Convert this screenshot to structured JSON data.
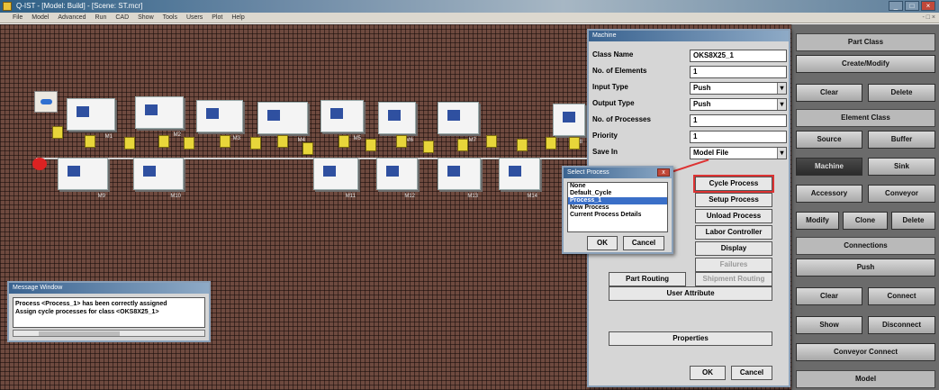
{
  "window": {
    "title": "Q-IST - [Model: Build] - [Scene: ST.mcr]",
    "controls": [
      "_",
      "□",
      "×"
    ]
  },
  "menubar": {
    "items": [
      "File",
      "Model",
      "Advanced",
      "Run",
      "CAD",
      "Show",
      "Tools",
      "Users",
      "Plot",
      "Help"
    ],
    "right": "- □ ×"
  },
  "workspace": {
    "machines_top": [
      {
        "label": "M1"
      },
      {
        "label": "M2"
      },
      {
        "label": "M3"
      },
      {
        "label": "M4"
      },
      {
        "label": "M5"
      },
      {
        "label": "M6"
      },
      {
        "label": "M7"
      },
      {
        "label": "M8"
      }
    ],
    "machines_bottom": [
      {
        "label": "M9"
      },
      {
        "label": "M10"
      },
      {
        "label": "M11"
      },
      {
        "label": "M12"
      },
      {
        "label": "M13"
      },
      {
        "label": "M14"
      }
    ]
  },
  "machine_dialog": {
    "title": "Machine",
    "fields": [
      {
        "label": "Class Name",
        "value": "OKS8X25_1"
      },
      {
        "label": "No. of Elements",
        "value": "1"
      },
      {
        "label": "Input Type",
        "value": "Push"
      },
      {
        "label": "Output Type",
        "value": "Push"
      },
      {
        "label": "No. of Processes",
        "value": "1"
      },
      {
        "label": "Priority",
        "value": "1"
      },
      {
        "label": "Save In",
        "value": "Model File"
      }
    ],
    "buttons": {
      "cycle_process": "Cycle Process",
      "setup_process": "Setup Process",
      "unload_process": "Unload Process",
      "labor_controller": "Labor Controller",
      "display": "Display",
      "failures": "Failures",
      "part_routing": "Part Routing",
      "shipment_routing": "Shipment Routing",
      "user_attribute": "User Attribute",
      "properties": "Properties",
      "ok": "OK",
      "cancel": "Cancel"
    }
  },
  "select_process_dialog": {
    "title": "Select Process",
    "items": [
      "None",
      "Default_Cycle",
      "Process_1",
      "New Process",
      "Current Process Details"
    ],
    "selected_index": 2,
    "ok": "OK",
    "cancel": "Cancel"
  },
  "message_window": {
    "title": "Message Window",
    "lines": [
      "Process <Process_1> has been correctly assigned",
      "Assign cycle processes for class <OKS8X25_1>"
    ]
  },
  "right_panel": {
    "part_class": "Part Class",
    "create_modify": "Create/Modify",
    "clear": "Clear",
    "delete": "Delete",
    "element_class": "Element Class",
    "source": "Source",
    "buffer": "Buffer",
    "machine": "Machine",
    "sink": "Sink",
    "accessory": "Accessory",
    "conveyor": "Conveyor",
    "modify": "Modify",
    "clone": "Clone",
    "delete2": "Delete",
    "connections": "Connections",
    "push": "Push",
    "clear2": "Clear",
    "connect": "Connect",
    "show": "Show",
    "disconnect": "Disconnect",
    "conveyor_connect": "Conveyor Connect",
    "model": "Model"
  }
}
